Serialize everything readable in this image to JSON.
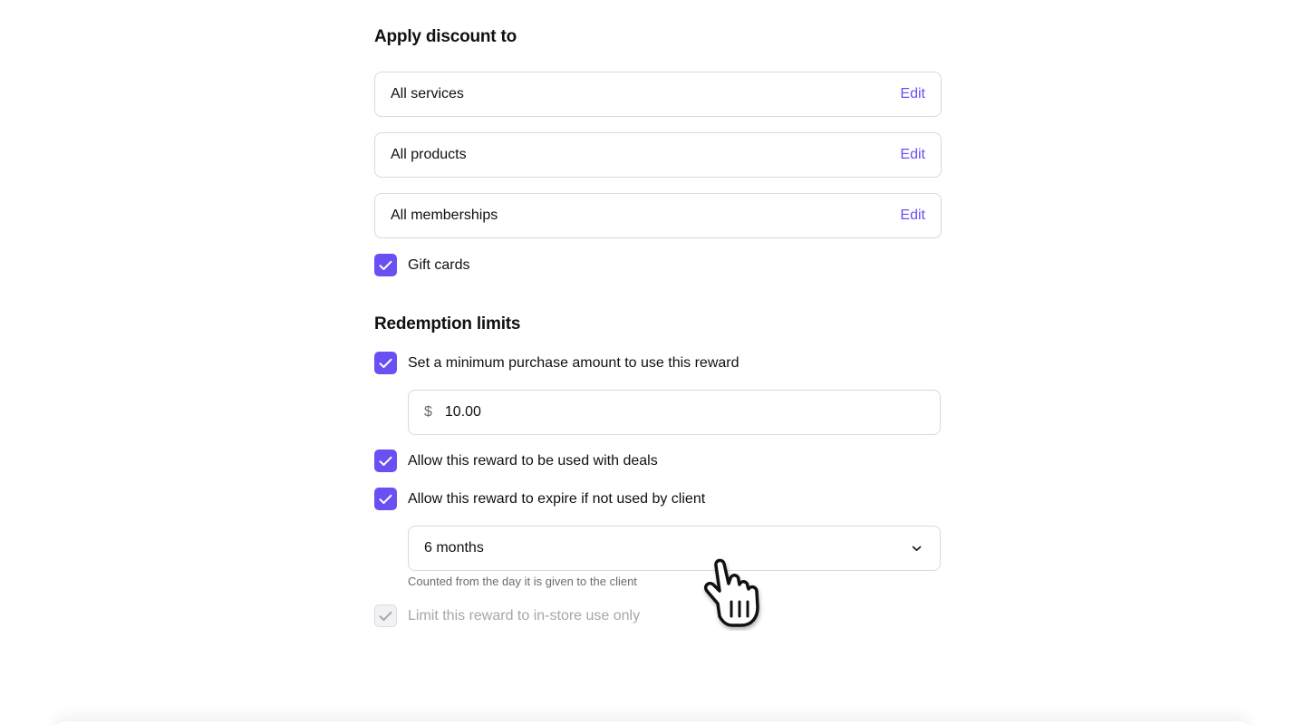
{
  "apply_section": {
    "title": "Apply discount to",
    "rows": [
      {
        "label": "All services",
        "action": "Edit"
      },
      {
        "label": "All products",
        "action": "Edit"
      },
      {
        "label": "All memberships",
        "action": "Edit"
      }
    ],
    "gift_cards": {
      "label": "Gift cards",
      "checked": true
    }
  },
  "redemption": {
    "title": "Redemption limits",
    "min_purchase": {
      "label": "Set a minimum purchase amount to use this reward",
      "checked": true,
      "currency": "$",
      "amount": "10.00"
    },
    "deals": {
      "label": "Allow this reward to be used with deals",
      "checked": true
    },
    "expire": {
      "label": "Allow this reward to expire if not used by client",
      "checked": true,
      "selected": "6 months",
      "helper": "Counted from the day it is given to the client"
    },
    "in_store": {
      "label": "Limit this reward to in-store use only",
      "checked": true,
      "disabled": true
    }
  },
  "colors": {
    "accent": "#6950f3",
    "border": "#d9d9de",
    "muted": "#6b6b73",
    "disabled_text": "#a6a6ad"
  }
}
